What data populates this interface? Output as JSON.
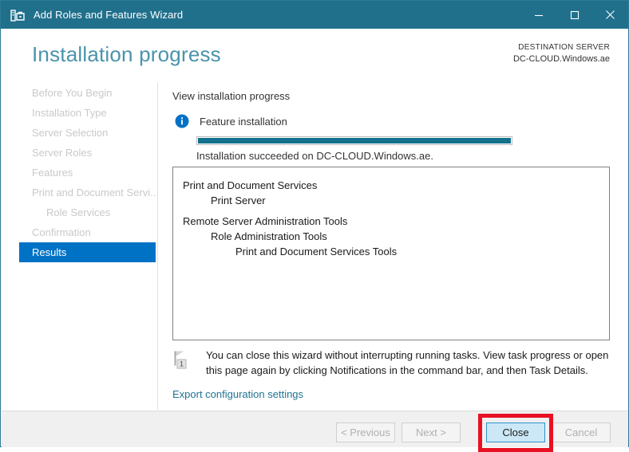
{
  "window": {
    "title": "Add Roles and Features Wizard",
    "app_icon": "server-toolbox-icon",
    "titlebar_color": "#20708c",
    "controls": {
      "minimize": "minimize-icon",
      "maximize": "maximize-icon",
      "close": "close-icon"
    }
  },
  "header": {
    "page_title": "Installation progress",
    "page_title_color": "#4a93ad",
    "destination_label": "DESTINATION SERVER",
    "destination_server": "DC-CLOUD.Windows.ae"
  },
  "sidebar": {
    "active_color": "#0072c6",
    "items": [
      {
        "label": "Before You Begin",
        "state": "disabled",
        "indent": false
      },
      {
        "label": "Installation Type",
        "state": "disabled",
        "indent": false
      },
      {
        "label": "Server Selection",
        "state": "disabled",
        "indent": false
      },
      {
        "label": "Server Roles",
        "state": "disabled",
        "indent": false
      },
      {
        "label": "Features",
        "state": "disabled",
        "indent": false
      },
      {
        "label": "Print and Document Servi...",
        "state": "disabled",
        "indent": false
      },
      {
        "label": "Role Services",
        "state": "disabled",
        "indent": true
      },
      {
        "label": "Confirmation",
        "state": "disabled",
        "indent": false
      },
      {
        "label": "Results",
        "state": "active",
        "indent": false
      }
    ]
  },
  "content": {
    "view_progress_label": "View installation progress",
    "info_icon": "info-circle-icon",
    "feature_label": "Feature installation",
    "progress": {
      "percent": 100,
      "fill_color": "#13718c"
    },
    "status_text": "Installation succeeded on DC-CLOUD.Windows.ae.",
    "results": [
      {
        "text": "Print and Document Services",
        "level": 0
      },
      {
        "text": "Print Server",
        "level": 1
      },
      {
        "text": "Remote Server Administration Tools",
        "level": 0
      },
      {
        "text": "Role Administration Tools",
        "level": 1
      },
      {
        "text": "Print and Document Services Tools",
        "level": 2
      }
    ],
    "note": {
      "icon": "notification-flag-icon",
      "badge": "1",
      "text": "You can close this wizard without interrupting running tasks. View task progress or open this page again by clicking Notifications in the command bar, and then Task Details."
    },
    "export_link": "Export configuration settings",
    "export_link_color": "#1f7391"
  },
  "footer": {
    "buttons": [
      {
        "label": "< Previous",
        "state": "disabled"
      },
      {
        "label": "Next >",
        "state": "disabled"
      },
      {
        "label": "Close",
        "state": "focused"
      },
      {
        "label": "Cancel",
        "state": "disabled"
      }
    ]
  },
  "annotation": {
    "highlight_target": "Close",
    "highlight_color": "#e81123"
  }
}
